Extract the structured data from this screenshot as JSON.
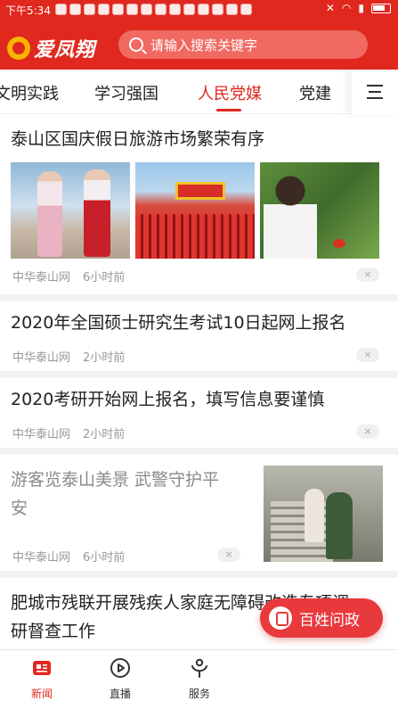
{
  "status_bar": {
    "time": "下午5:34",
    "notification_count": 14
  },
  "header": {
    "app_name": "爱凤翔",
    "search_placeholder": "请输入搜索关键字"
  },
  "tabs": [
    {
      "label": "文明实践",
      "active": false
    },
    {
      "label": "学习强国",
      "active": false
    },
    {
      "label": "人民党媒",
      "active": true
    },
    {
      "label": "党建",
      "active": false
    }
  ],
  "articles": [
    {
      "title": "泰山区国庆假日旅游市场繁荣有序",
      "source": "中华泰山网",
      "time": "6小时前",
      "close_icon": "×"
    },
    {
      "title": "2020年全国硕士研究生考试10日起网上报名",
      "source": "中华泰山网",
      "time": "2小时前",
      "close_icon": "×"
    },
    {
      "title": "2020考研开始网上报名，填写信息要谨慎",
      "source": "中华泰山网",
      "time": "2小时前",
      "close_icon": "×"
    },
    {
      "title_line1": "游客览泰山美景 武警守护平",
      "title_line2": "安",
      "source": "中华泰山网",
      "time": "6小时前",
      "close_icon": "×"
    },
    {
      "title_line1": "肥城市残联开展残疾人家庭无障碍改造专项调",
      "title_line2": "研督查工作"
    }
  ],
  "fab": {
    "label": "百姓问政"
  },
  "bottom_nav": [
    {
      "label": "新闻",
      "icon": "news-icon",
      "active": true
    },
    {
      "label": "直播",
      "icon": "play-icon",
      "active": false
    },
    {
      "label": "服务",
      "icon": "service-icon",
      "active": false
    }
  ],
  "colors": {
    "brand_red": "#e0281e",
    "fab_red": "#e8393c"
  }
}
